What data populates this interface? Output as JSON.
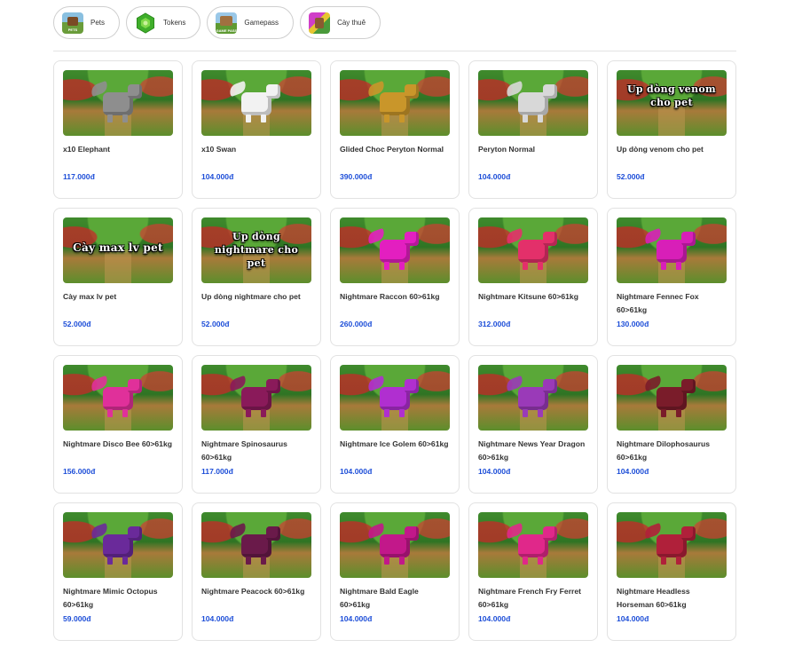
{
  "tabs": [
    {
      "label": "Pets",
      "icon": "pets-thumb-icon",
      "mini": "PETS"
    },
    {
      "label": "Tokens",
      "icon": "token-icon"
    },
    {
      "label": "Gamepass",
      "icon": "gamepass-thumb-icon",
      "mini": "GAME PASS"
    },
    {
      "label": "Cày thuê",
      "icon": "cay-thue-thumb-icon"
    }
  ],
  "accent_color": "#1d4ed8",
  "products": [
    {
      "name": "x10 Elephant",
      "price": "117.000đ",
      "art": "creature",
      "color": "#8e8e8e"
    },
    {
      "name": "x10 Swan",
      "price": "104.000đ",
      "art": "creature",
      "color": "#f2f2f2"
    },
    {
      "name": "Glided Choc Peryton Normal",
      "price": "390.000đ",
      "art": "creature",
      "color": "#c9962a"
    },
    {
      "name": "Peryton Normal",
      "price": "104.000đ",
      "art": "creature",
      "color": "#d8d8d8"
    },
    {
      "name": "Up dòng venom cho pet",
      "price": "52.000đ",
      "art": "banner",
      "banner": "Up dòng venom cho pet"
    },
    {
      "name": "Cày max lv pet",
      "price": "52.000đ",
      "art": "banner",
      "banner": "Cày max lv pet"
    },
    {
      "name": "Up dòng nightmare cho pet",
      "price": "52.000đ",
      "art": "banner",
      "banner": "Up dòng nightmare cho pet"
    },
    {
      "name": "Nightmare Raccon 60>61kg",
      "price": "260.000đ",
      "art": "creature",
      "color": "#e31fc0"
    },
    {
      "name": "Nightmare Kitsune 60>61kg",
      "price": "312.000đ",
      "art": "creature",
      "color": "#e3306a"
    },
    {
      "name": "Nightmare Fennec Fox 60>61kg",
      "price": "130.000đ",
      "art": "creature",
      "color": "#d81fb8"
    },
    {
      "name": "Nightmare Disco Bee 60>61kg",
      "price": "156.000đ",
      "art": "creature",
      "color": "#e0309a"
    },
    {
      "name": "Nightmare Spinosaurus 60>61kg",
      "price": "117.000đ",
      "art": "creature",
      "color": "#8a1a5a"
    },
    {
      "name": "Nightmare Ice Golem 60>61kg",
      "price": "104.000đ",
      "art": "creature",
      "color": "#b02fd0"
    },
    {
      "name": "Nightmare News Year Dragon 60>61kg",
      "price": "104.000đ",
      "art": "creature",
      "color": "#9a3ab8"
    },
    {
      "name": "Nightmare Dilophosaurus 60>61kg",
      "price": "104.000đ",
      "art": "creature",
      "color": "#7a1c2a"
    },
    {
      "name": "Nightmare Mimic Octopus 60>61kg",
      "price": "59.000đ",
      "art": "creature",
      "color": "#6a2a9a"
    },
    {
      "name": "Nightmare Peacock 60>61kg",
      "price": "104.000đ",
      "art": "creature",
      "color": "#6a1a4a"
    },
    {
      "name": "Nightmare Bald Eagle 60>61kg",
      "price": "104.000đ",
      "art": "creature",
      "color": "#c2188a"
    },
    {
      "name": "Nightmare French Fry Ferret 60>61kg",
      "price": "104.000đ",
      "art": "creature",
      "color": "#e0288a"
    },
    {
      "name": "Nightmare Headless Horseman 60>61kg",
      "price": "104.000đ",
      "art": "creature",
      "color": "#b0203a"
    }
  ]
}
